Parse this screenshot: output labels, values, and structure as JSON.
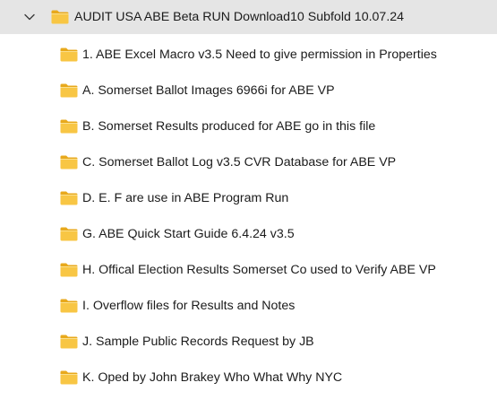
{
  "tree": {
    "parent": {
      "label": "AUDIT USA ABE Beta RUN Download10 Subfold 10.07.24",
      "expanded": true,
      "icon": "folder-icon",
      "chevron_icon": "chevron-down-icon"
    },
    "children": [
      {
        "label": "1. ABE Excel Macro v3.5 Need to give permission in Properties",
        "icon": "folder-icon"
      },
      {
        "label": "A. Somerset Ballot Images 6966i for ABE VP",
        "icon": "folder-icon"
      },
      {
        "label": "B. Somerset Results produced for ABE go in this file",
        "icon": "folder-icon"
      },
      {
        "label": "C.  Somerset Ballot Log v3.5 CVR Database for ABE VP",
        "icon": "folder-icon"
      },
      {
        "label": "D. E. F are use in ABE Program Run",
        "icon": "folder-icon"
      },
      {
        "label": "G. ABE Quick Start Guide 6.4.24 v3.5",
        "icon": "folder-icon"
      },
      {
        "label": "H. Offical Election Results Somerset Co used to Verify ABE VP",
        "icon": "folder-icon"
      },
      {
        "label": "I. Overflow files for Results and Notes",
        "icon": "folder-icon"
      },
      {
        "label": "J.  Sample Public Records Request by JB",
        "icon": "folder-icon"
      },
      {
        "label": "K. Oped by John Brakey Who What Why NYC",
        "icon": "folder-icon"
      }
    ]
  },
  "colors": {
    "selected_background": "#e5e5e5",
    "folder_body": "#f8c644",
    "folder_tab": "#e8a91c",
    "text": "#1b1b1b"
  }
}
